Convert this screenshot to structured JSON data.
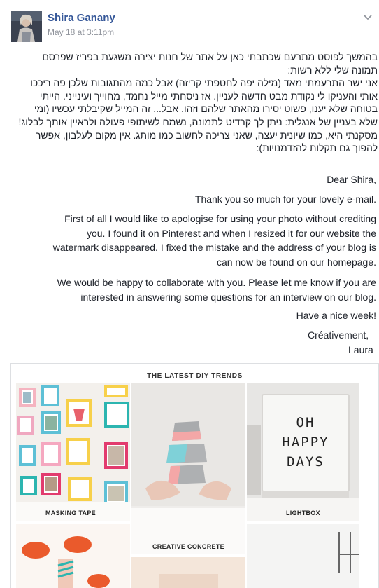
{
  "post": {
    "author": "Shira Ganany",
    "timestamp": "May 18 at 3:11pm",
    "menu_icon": "chevron-down-icon",
    "hebrew_lines": [
      "בהמשך לפוסט מתרעם שכתבתי כאן על אתר של חנות יצירה משגעת בפריז שפרסם",
      "תמונה שלי ללא רשות:",
      "אני ישר התרעמתי מאד (מילה יפה לחטפתי קריזה) אבל כמה מהתגובות שלכן פה ריככו",
      "אותי והעניקו לי נקודת מבט חדשה לעניין. אז ניסחתי מייל נחמד, מחוייך ועינייני. הייתי",
      "בטוחה שלא יענו, פשוט יסירו מהאתר שלהם וזהו. אבל... זה המייל שקיבלתי עכשיו (ומי",
      "שלא בעניין של אנגלית: ניתן לך קרדיט לתמונה, נשמח לשיתופי פעולה ולראיין אותך לבלוג!",
      "מסקנתי היא, כמו שיונית יעצה, שאני צריכה לחשוב כמו מותג. אין מקום לעלבון, אפשר",
      "להפוך גם תקלות להזדמנויות):"
    ],
    "email": {
      "greeting": "Dear Shira,",
      "thanks": "Thank you so much for your lovely e-mail.",
      "apology_lines": [
        "First of all I would like to apologise for using your photo without crediting",
        "you. I found it on Pinterest and when I resized it for our website the",
        "watermark disappeared. I fixed the mistake and the address of your blog is",
        "can now be found on our homepage."
      ],
      "collab_lines": [
        "We would be happy to collaborate with you. Please let me know if you are",
        "interested in answering some questions for an interview on our blog."
      ],
      "closing": "Have a nice week!",
      "signoff": "Créativement,",
      "signature": "Laura"
    }
  },
  "attachment": {
    "title": "THE LATEST DIY TRENDS",
    "labels": {
      "masking_tape": "MASKING TAPE",
      "creative_concrete": "CREATIVE CONCRETE",
      "lightbox": "LIGHTBOX"
    },
    "lightbox_lines": [
      "OH",
      "HAPPY",
      "DAYS"
    ]
  }
}
